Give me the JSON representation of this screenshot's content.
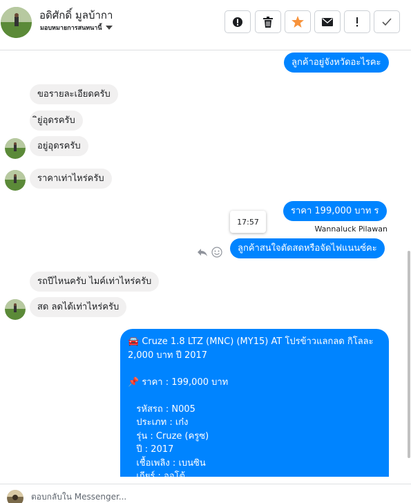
{
  "header": {
    "contact_name": "อดิศักดิ์ มูลบ้ากา",
    "assignment": "มอบหมายการสนทนานี้",
    "buttons": {
      "spam_icon": "alert-circle-icon",
      "delete_icon": "trash-icon",
      "star_icon": "star-icon",
      "unread_icon": "envelope-icon",
      "follow_up_icon": "exclamation-icon",
      "done_icon": "check-icon"
    },
    "colors": {
      "star": "#f7923a"
    }
  },
  "messages": {
    "m1": "ลูกค้าอยู่จังหวัดอะไรคะ",
    "m2": "ขอรายละเอียดครับ",
    "m3": "ิยู่อุดรครับ",
    "m4": "อยู่อุดรครับ",
    "m5": "ราคาเท่าไหร่ครับ",
    "m6": "ราคา 199,000 บาท   ร",
    "m6_time": "17:57",
    "m6_sender": "Wannaluck Pilawan",
    "m7": "ลูกค้าสนใจตัดสดหรือจัดไฟแนนซ์คะ",
    "m8": "รถปีไหนครับ ไมค์เท่าไหร่ครับ",
    "m9": "สด ลดได้เท่าไหร่ครับ",
    "long": {
      "l1": "🚘 Cruze 1.8 LTZ (MNC) (MY15) AT โปรข้าวแลกลด กิโลละ",
      "l2": "2,000 บาท ปี 2017",
      "l3": "",
      "l4": "📌 ราคา : 199,000 บาท",
      "l5": "",
      "l6": "   รหัสรถ : N005",
      "l7": "   ประเภท : เก๋ง",
      "l8": "   รุ่น : Cruze (ครูซ)",
      "l9": "   ปี : 2017",
      "l10": "   เชื้อเพลิง : เบนซิน",
      "l11": "   เกียร์ : ออโต้"
    }
  },
  "message_actions": {
    "reply_icon": "reply-icon",
    "react_icon": "smiley-icon"
  },
  "composer": {
    "placeholder": "ตอบกลับใน Messenger..."
  },
  "colors": {
    "outgoing": "#0084ff",
    "incoming": "#f1f0f0"
  }
}
